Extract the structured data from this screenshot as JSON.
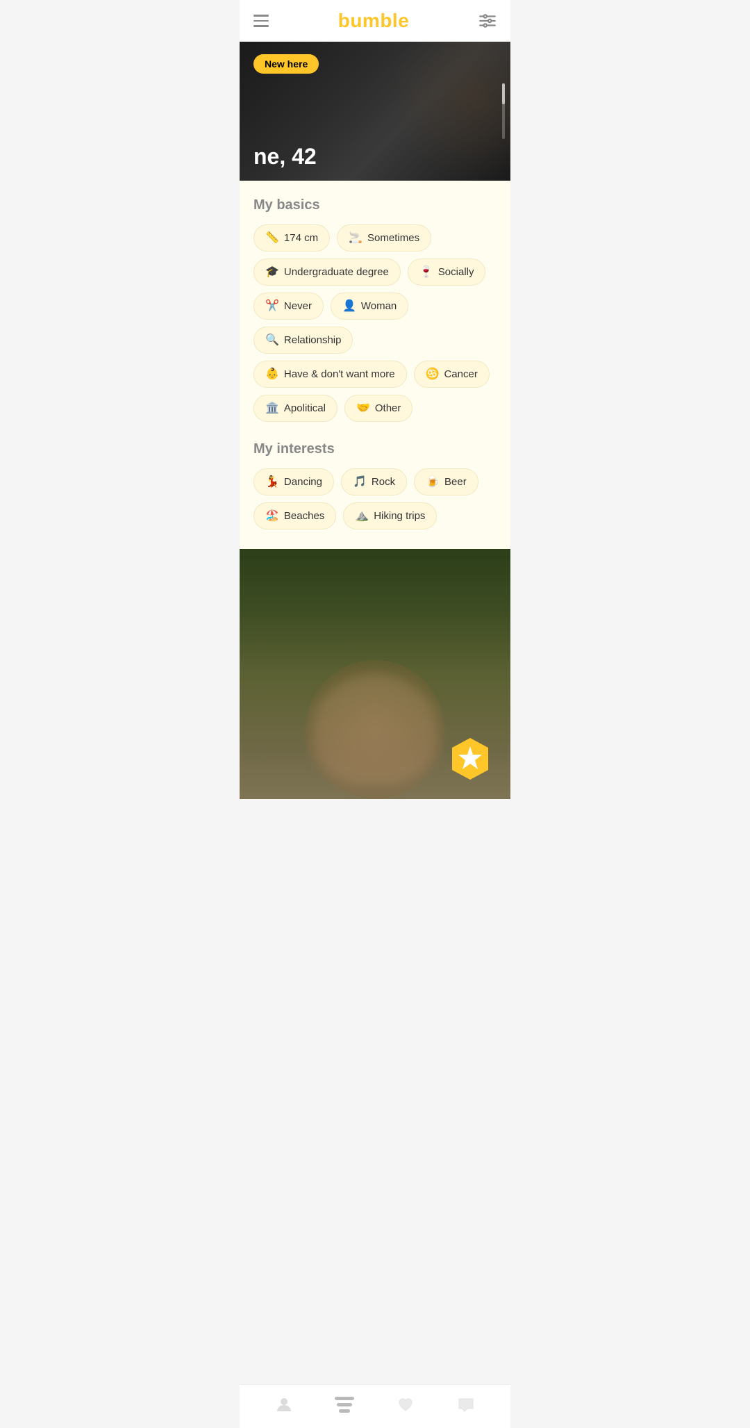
{
  "header": {
    "title": "bumble",
    "menu_label": "menu",
    "filter_label": "filter"
  },
  "profile": {
    "new_here_badge": "New here",
    "name_age": "ne, 42",
    "photo_alt": "profile photo"
  },
  "basics": {
    "section_title": "My basics",
    "tags": [
      {
        "icon": "📏",
        "label": "174 cm"
      },
      {
        "icon": "🚬",
        "label": "Sometimes"
      },
      {
        "icon": "🎓",
        "label": "Undergraduate degree"
      },
      {
        "icon": "🍷",
        "label": "Socially"
      },
      {
        "icon": "✂️",
        "label": "Never"
      },
      {
        "icon": "👤",
        "label": "Woman"
      },
      {
        "icon": "🔍",
        "label": "Relationship"
      },
      {
        "icon": "👶",
        "label": "Have & don't want more"
      },
      {
        "icon": "♋",
        "label": "Cancer"
      },
      {
        "icon": "🏛️",
        "label": "Apolitical"
      },
      {
        "icon": "🤝",
        "label": "Other"
      }
    ]
  },
  "interests": {
    "section_title": "My interests",
    "tags": [
      {
        "icon": "💃",
        "label": "Dancing"
      },
      {
        "icon": "🎵",
        "label": "Rock"
      },
      {
        "icon": "🍺",
        "label": "Beer"
      },
      {
        "icon": "🏖️",
        "label": "Beaches"
      },
      {
        "icon": "⛰️",
        "label": "Hiking trips"
      }
    ]
  },
  "nav": {
    "items": [
      {
        "label": "profile",
        "icon": "person"
      },
      {
        "label": "matches",
        "icon": "stack"
      },
      {
        "label": "likes",
        "icon": "heart"
      },
      {
        "label": "messages",
        "icon": "chat"
      }
    ]
  },
  "star_badge": {
    "label": "superswipe"
  }
}
